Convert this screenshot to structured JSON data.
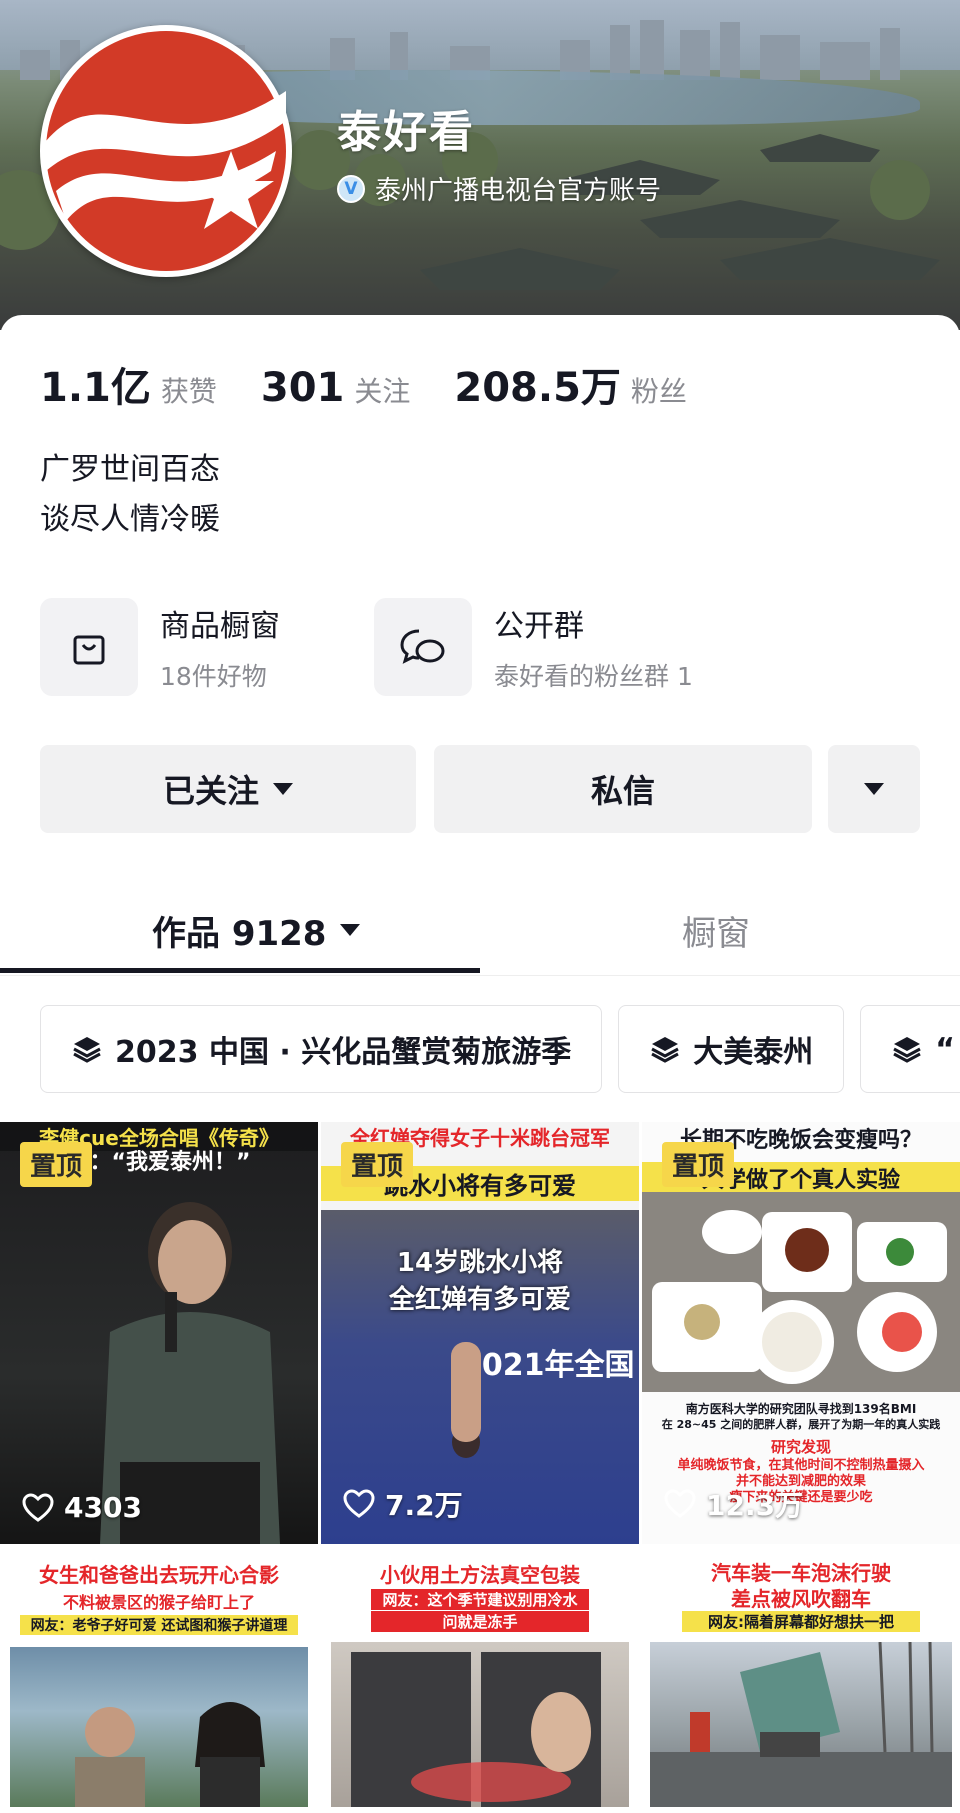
{
  "profile": {
    "name": "泰好看",
    "verified_text": "泰州广播电视台官方账号"
  },
  "stats": [
    {
      "value": "1.1亿",
      "label": "获赞"
    },
    {
      "value": "301",
      "label": "关注"
    },
    {
      "value": "208.5万",
      "label": "粉丝"
    }
  ],
  "bio": {
    "line1": "广罗世间百态",
    "line2": "谈尽人情冷暖"
  },
  "features": [
    {
      "title": "商品橱窗",
      "subtitle": "18件好物",
      "icon": "shopping-bag-icon"
    },
    {
      "title": "公开群",
      "subtitle": "泰好看的粉丝群 1",
      "icon": "chat-bubbles-icon"
    }
  ],
  "buttons": {
    "follow_label": "已关注",
    "message_label": "私信"
  },
  "tabs": {
    "works_label": "作品 9128",
    "shop_label": "橱窗"
  },
  "chips": [
    {
      "label": "2023 中国 · 兴化品蟹赏菊旅游季"
    },
    {
      "label": "大美泰州"
    },
    {
      "label": "“"
    }
  ],
  "videos": [
    {
      "pinned": "置顶",
      "likes": "4303",
      "caption_top": "李健cue全场合唱《传奇》",
      "caption_sub": "白：“我爱泰州！”"
    },
    {
      "pinned": "置顶",
      "likes": "7.2万",
      "caption_top": "全红婵夺得女子十米跳台冠军",
      "caption_sub": "跳水小将有多可爱",
      "overlay": "14岁跳水小将\n全红婵有多可爱",
      "overlay_line1": "14岁跳水小将",
      "overlay_line2": "全红婵有多可爱",
      "board_text": "2021年全国"
    },
    {
      "pinned": "置顶",
      "likes": "12.3万",
      "caption_top": "长期不吃晚饭会变瘦吗？",
      "caption_sub": "大学做了个真人实验",
      "note1": "南方医科大学的研究团队寻找到139名BMI",
      "note2": "在 28~45 之间的肥胖人群，展开了为期一年的真人实践",
      "note3": "研究发现",
      "note4": "单纯晚饭节食，在其他时间不控制热量摄入",
      "note5": "并不能达到减肥的效果",
      "note6": "瘦下来的关键还是要少吃"
    },
    {
      "caption_top": "女生和爸爸出去玩开心合影",
      "caption_sub": "不料被景区的猴子给盯上了",
      "caption_note": "网友：老爷子好可爱 还试图和猴子讲道理"
    },
    {
      "caption_top": "小伙用土方法真空包装",
      "caption_sub": "网友：这个季节建议别用冷水",
      "caption_sub2": "问就是冻手"
    },
    {
      "caption_top": "汽车装一车泡沫行驶",
      "caption_sub": "差点被风吹翻车",
      "caption_note": "网友:隔着屏幕都好想扶一把"
    }
  ],
  "colors": {
    "pin_bg": "#f6d64a",
    "logo_red": "#d23a27",
    "caption_yellow": "#f5e14a",
    "caption_red": "#e4262a"
  }
}
